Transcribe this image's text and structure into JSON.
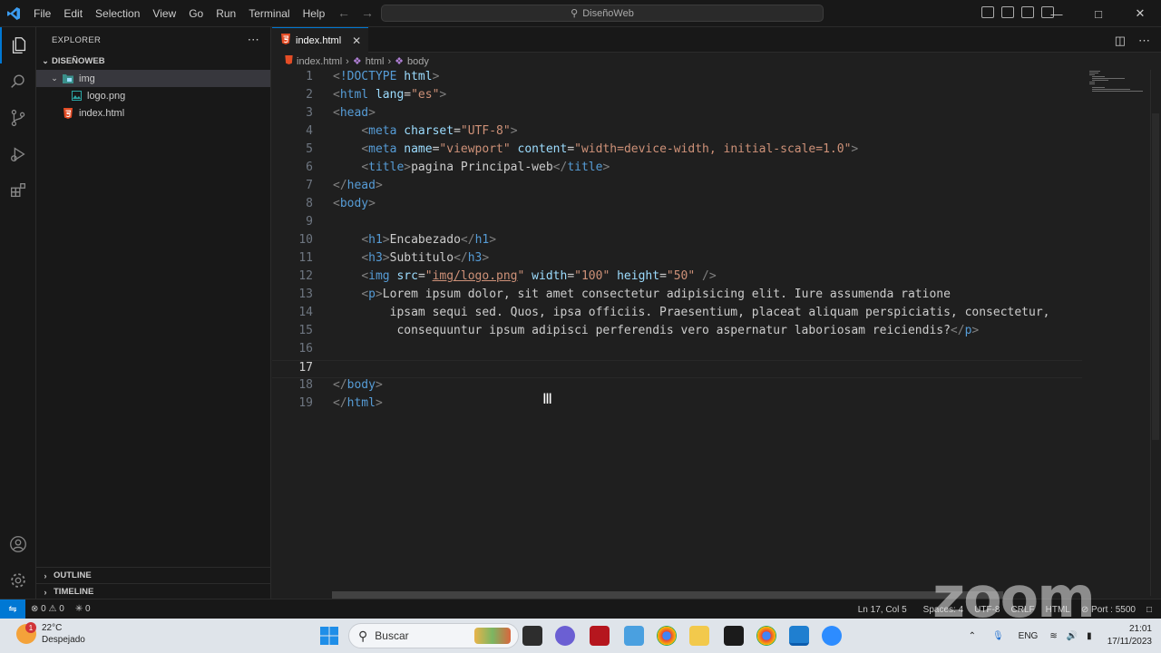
{
  "menu": [
    "File",
    "Edit",
    "Selection",
    "View",
    "Go",
    "Run",
    "Terminal",
    "Help"
  ],
  "command_center": {
    "title": "DiseñoWeb"
  },
  "explorer": {
    "header": "EXPLORER",
    "root": "DISEÑOWEB",
    "items": [
      {
        "label": "img",
        "type": "folder"
      },
      {
        "label": "logo.png",
        "type": "image"
      },
      {
        "label": "index.html",
        "type": "html"
      }
    ],
    "outline": "OUTLINE",
    "timeline": "TIMELINE"
  },
  "editor": {
    "tab": "index.html",
    "breadcrumb": [
      "index.html",
      "html",
      "body"
    ],
    "line_numbers": [
      "1",
      "2",
      "3",
      "4",
      "5",
      "6",
      "7",
      "8",
      "9",
      "10",
      "11",
      "12",
      "13",
      "14",
      "15",
      "16",
      "17",
      "18",
      "19"
    ],
    "lines": [
      [
        [
          "pun",
          "<"
        ],
        [
          "tag",
          "!DOCTYPE"
        ],
        [
          "txt",
          " "
        ],
        [
          "attr",
          "html"
        ],
        [
          "pun",
          ">"
        ]
      ],
      [
        [
          "pun",
          "<"
        ],
        [
          "tag",
          "html"
        ],
        [
          "txt",
          " "
        ],
        [
          "attr",
          "lang"
        ],
        [
          "txt",
          "="
        ],
        [
          "str",
          "\"es\""
        ],
        [
          "pun",
          ">"
        ]
      ],
      [
        [
          "pun",
          "<"
        ],
        [
          "tag",
          "head"
        ],
        [
          "pun",
          ">"
        ]
      ],
      [
        [
          "txt",
          "    "
        ],
        [
          "pun",
          "<"
        ],
        [
          "tag",
          "meta"
        ],
        [
          "txt",
          " "
        ],
        [
          "attr",
          "charset"
        ],
        [
          "txt",
          "="
        ],
        [
          "str",
          "\"UTF-8\""
        ],
        [
          "pun",
          ">"
        ]
      ],
      [
        [
          "txt",
          "    "
        ],
        [
          "pun",
          "<"
        ],
        [
          "tag",
          "meta"
        ],
        [
          "txt",
          " "
        ],
        [
          "attr",
          "name"
        ],
        [
          "txt",
          "="
        ],
        [
          "str",
          "\"viewport\""
        ],
        [
          "txt",
          " "
        ],
        [
          "attr",
          "content"
        ],
        [
          "txt",
          "="
        ],
        [
          "str",
          "\"width=device-width, initial-scale=1.0\""
        ],
        [
          "pun",
          ">"
        ]
      ],
      [
        [
          "txt",
          "    "
        ],
        [
          "pun",
          "<"
        ],
        [
          "tag",
          "title"
        ],
        [
          "pun",
          ">"
        ],
        [
          "txt",
          "pagina Principal-web"
        ],
        [
          "pun",
          "</"
        ],
        [
          "tag",
          "title"
        ],
        [
          "pun",
          ">"
        ]
      ],
      [
        [
          "pun",
          "</"
        ],
        [
          "tag",
          "head"
        ],
        [
          "pun",
          ">"
        ]
      ],
      [
        [
          "pun",
          "<"
        ],
        [
          "tag",
          "body"
        ],
        [
          "pun",
          ">"
        ]
      ],
      [],
      [
        [
          "txt",
          "    "
        ],
        [
          "pun",
          "<"
        ],
        [
          "tag",
          "h1"
        ],
        [
          "pun",
          ">"
        ],
        [
          "txt",
          "Encabezado"
        ],
        [
          "pun",
          "</"
        ],
        [
          "tag",
          "h1"
        ],
        [
          "pun",
          ">"
        ]
      ],
      [
        [
          "txt",
          "    "
        ],
        [
          "pun",
          "<"
        ],
        [
          "tag",
          "h3"
        ],
        [
          "pun",
          ">"
        ],
        [
          "txt",
          "Subtitulo"
        ],
        [
          "pun",
          "</"
        ],
        [
          "tag",
          "h3"
        ],
        [
          "pun",
          ">"
        ]
      ],
      [
        [
          "txt",
          "    "
        ],
        [
          "pun",
          "<"
        ],
        [
          "tag",
          "img"
        ],
        [
          "txt",
          " "
        ],
        [
          "attr",
          "src"
        ],
        [
          "txt",
          "="
        ],
        [
          "str",
          "\""
        ],
        [
          "link",
          "img/logo.png"
        ],
        [
          "str",
          "\""
        ],
        [
          "txt",
          " "
        ],
        [
          "attr",
          "width"
        ],
        [
          "txt",
          "="
        ],
        [
          "str",
          "\"100\""
        ],
        [
          "txt",
          " "
        ],
        [
          "attr",
          "height"
        ],
        [
          "txt",
          "="
        ],
        [
          "str",
          "\"50\""
        ],
        [
          "txt",
          " "
        ],
        [
          "pun",
          "/>"
        ]
      ],
      [
        [
          "txt",
          "    "
        ],
        [
          "pun",
          "<"
        ],
        [
          "tag",
          "p"
        ],
        [
          "pun",
          ">"
        ],
        [
          "txt",
          "Lorem ipsum dolor, sit amet consectetur adipisicing elit. Iure assumenda ratione"
        ]
      ],
      [
        [
          "txt",
          "        ipsam sequi sed. Quos, ipsa officiis. Praesentium, placeat aliquam perspiciatis, consectetur,"
        ]
      ],
      [
        [
          "txt",
          "         consequuntur ipsum adipisci perferendis vero aspernatur laboriosam reiciendis?"
        ],
        [
          "pun",
          "</"
        ],
        [
          "tag",
          "p"
        ],
        [
          "pun",
          ">"
        ]
      ],
      [],
      [],
      [
        [
          "pun",
          "</"
        ],
        [
          "tag",
          "body"
        ],
        [
          "pun",
          ">"
        ]
      ],
      [
        [
          "pun",
          "</"
        ],
        [
          "tag",
          "html"
        ],
        [
          "pun",
          ">"
        ]
      ]
    ]
  },
  "statusbar": {
    "errors": "0",
    "warnings": "0",
    "ports": "0",
    "position": "Ln 17, Col 5",
    "spaces": "Spaces: 4",
    "encoding": "UTF-8",
    "eol": "CRLF",
    "language": "HTML",
    "port": "Port : 5500"
  },
  "taskbar": {
    "temperature": "22°C",
    "weather": "Despejado",
    "weather_badge": "1",
    "search_placeholder": "Buscar",
    "language": "ENG",
    "time": "21:01",
    "date": "17/11/2023"
  },
  "watermark": "zoom",
  "colors": {
    "accent": "#0078d4",
    "editor_bg": "#1f1f1f",
    "sidebar_bg": "#181818"
  }
}
